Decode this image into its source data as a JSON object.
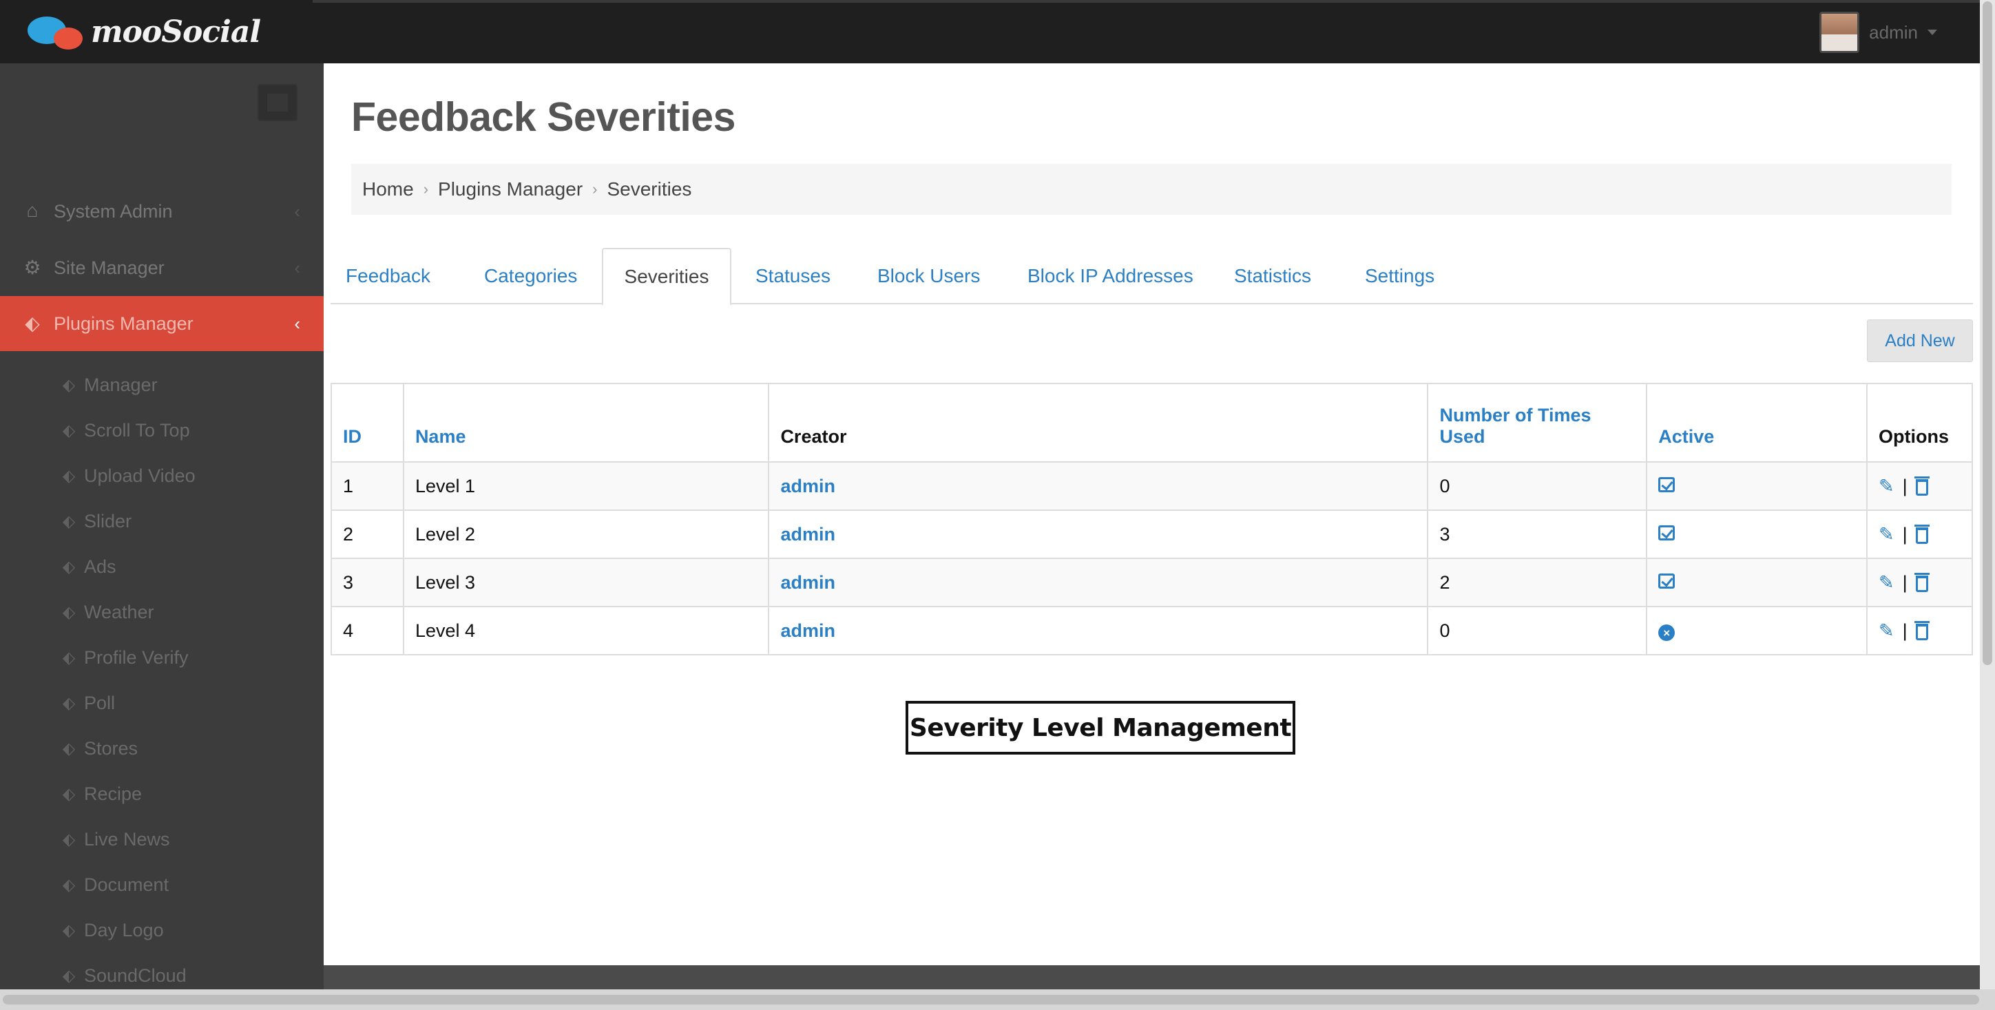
{
  "app": {
    "logo_text": "mooSocial",
    "user_name": "admin"
  },
  "sidebar": {
    "main_items": [
      {
        "label": "System Admin",
        "icon": "home-icon"
      },
      {
        "label": "Site Manager",
        "icon": "cogs-icon"
      },
      {
        "label": "Plugins Manager",
        "icon": "tag-icon"
      }
    ],
    "sub_items": [
      {
        "label": "Manager"
      },
      {
        "label": "Scroll To Top"
      },
      {
        "label": "Upload Video"
      },
      {
        "label": "Slider"
      },
      {
        "label": "Ads"
      },
      {
        "label": "Weather"
      },
      {
        "label": "Profile Verify"
      },
      {
        "label": "Poll"
      },
      {
        "label": "Stores"
      },
      {
        "label": "Recipe"
      },
      {
        "label": "Live News"
      },
      {
        "label": "Document"
      },
      {
        "label": "Day Logo"
      },
      {
        "label": "SoundCloud"
      }
    ]
  },
  "page": {
    "title": "Feedback Severities",
    "breadcrumb": [
      "Home",
      "Plugins Manager",
      "Severities"
    ]
  },
  "tabs": [
    {
      "label": "Feedback"
    },
    {
      "label": "Categories"
    },
    {
      "label": "Severities"
    },
    {
      "label": "Statuses"
    },
    {
      "label": "Block Users"
    },
    {
      "label": "Block IP Addresses"
    },
    {
      "label": "Statistics"
    },
    {
      "label": "Settings"
    }
  ],
  "add_new_label": "Add New",
  "table": {
    "headers": {
      "id": "ID",
      "name": "Name",
      "creator": "Creator",
      "times_used": "Number of Times Used",
      "active": "Active",
      "options": "Options"
    },
    "rows": [
      {
        "id": "1",
        "name": "Level 1",
        "creator": "admin",
        "times_used": "0",
        "active": true
      },
      {
        "id": "2",
        "name": "Level 2",
        "creator": "admin",
        "times_used": "3",
        "active": true
      },
      {
        "id": "3",
        "name": "Level 3",
        "creator": "admin",
        "times_used": "2",
        "active": true
      },
      {
        "id": "4",
        "name": "Level 4",
        "creator": "admin",
        "times_used": "0",
        "active": false
      }
    ],
    "option_separator": "|"
  },
  "banner": "Severity Level Management",
  "colors": {
    "accent": "#2a7fc5",
    "active_nav": "#d8493a",
    "sidebar": "#3c3c3c",
    "topbar": "#1f1f1f"
  }
}
